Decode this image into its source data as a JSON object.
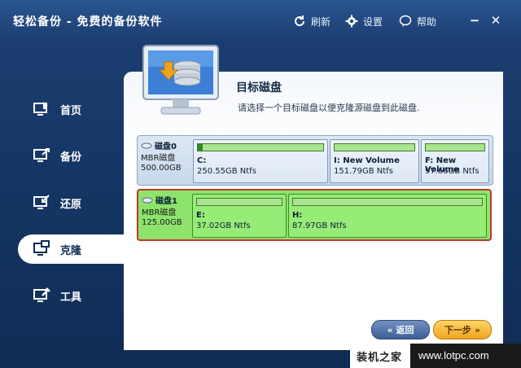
{
  "window": {
    "title": "轻松备份 - 免费的备份软件"
  },
  "toolbar": {
    "refresh": "刷新",
    "settings": "设置",
    "help": "帮助"
  },
  "sidebar": {
    "items": [
      {
        "label": "首页",
        "icon": "home-monitor-icon"
      },
      {
        "label": "备份",
        "icon": "backup-monitor-icon"
      },
      {
        "label": "还原",
        "icon": "restore-monitor-icon"
      },
      {
        "label": "克隆",
        "icon": "clone-monitor-icon",
        "active": true
      },
      {
        "label": "工具",
        "icon": "tools-monitor-icon"
      }
    ]
  },
  "content": {
    "title": "目标磁盘",
    "subtitle": "请选择一个目标磁盘以便克隆源磁盘到此磁盘."
  },
  "disks": [
    {
      "name": "磁盘0",
      "type": "MBR磁盘",
      "size": "500.00GB",
      "partitions": [
        {
          "label": "C:",
          "size": "250.55GB Ntfs",
          "used_fraction": 0.02
        },
        {
          "label": "I: New Volume",
          "size": "151.79GB Ntfs",
          "used_fraction": 0
        },
        {
          "label": "F: New Volume",
          "size": "97.66GB Ntfs",
          "used_fraction": 0
        }
      ]
    },
    {
      "name": "磁盘1",
      "type": "MBR磁盘",
      "size": "125.00GB",
      "selected": true,
      "partitions": [
        {
          "label": "E:",
          "size": "37.02GB Ntfs",
          "used_fraction": 0
        },
        {
          "label": "H:",
          "size": "87.97GB Ntfs",
          "used_fraction": 0
        }
      ]
    }
  ],
  "buttons": {
    "back": "返回",
    "next": "下一步"
  },
  "watermark": {
    "brand": "装机之家",
    "url": "www.lotpc.com"
  },
  "colors": {
    "accent": "#f0a41c",
    "selection": "#c0392b",
    "partition_green": "#8de36c"
  }
}
